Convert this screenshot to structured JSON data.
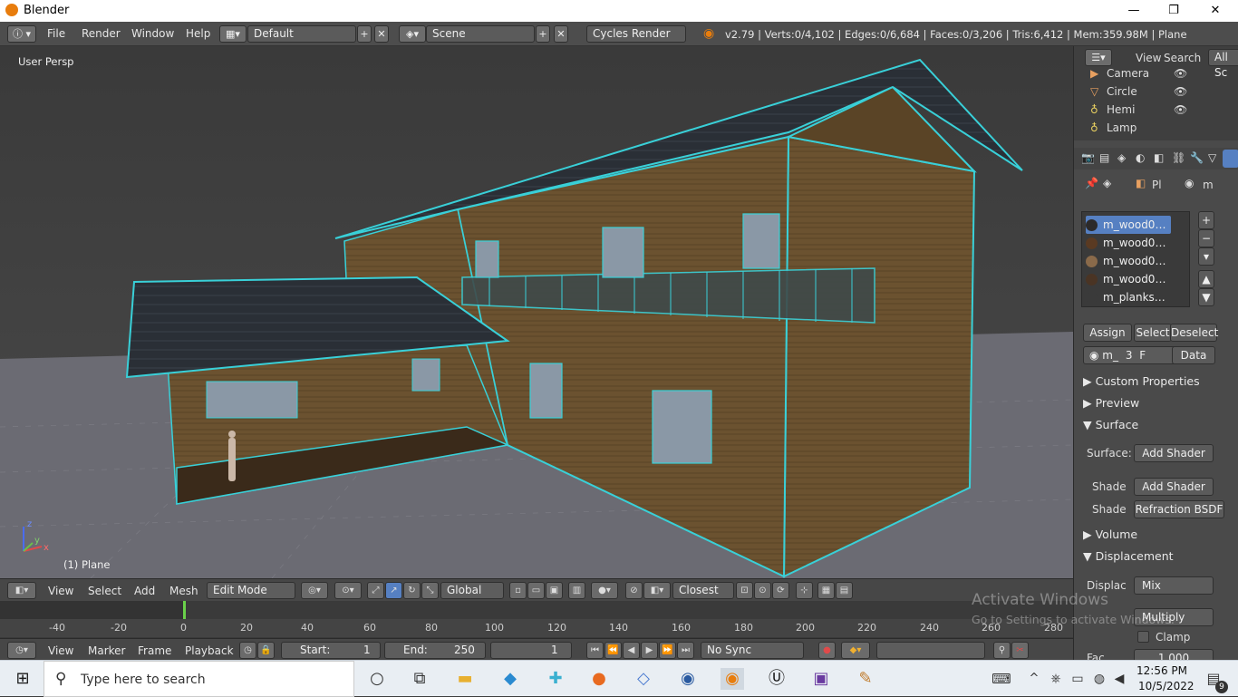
{
  "window": {
    "title": "Blender",
    "minimize": "—",
    "restore": "❐",
    "close": "✕"
  },
  "menubar": {
    "items": [
      "File",
      "Render",
      "Window",
      "Help"
    ],
    "layout": "Default",
    "scene": "Scene",
    "engine": "Cycles Render",
    "stats": "v2.79 | Verts:0/4,102 | Edges:0/6,684 | Faces:0/3,206 | Tris:6,412 | Mem:359.98M | Plane"
  },
  "viewport": {
    "view_label": "User Persp",
    "object_label": "(1) Plane",
    "axis_x": "x",
    "axis_y": "y",
    "axis_z": "z"
  },
  "viewport_header": {
    "menus": [
      "View",
      "Select",
      "Add",
      "Mesh"
    ],
    "mode": "Edit Mode",
    "orientation": "Global",
    "snap": "Closest"
  },
  "timeline": {
    "ticks": [
      "-40",
      "-20",
      "0",
      "20",
      "40",
      "60",
      "80",
      "100",
      "120",
      "140",
      "160",
      "180",
      "200",
      "220",
      "240",
      "260",
      "280"
    ],
    "menus": [
      "View",
      "Marker",
      "Frame",
      "Playback"
    ],
    "start_label": "Start:",
    "start_value": "1",
    "end_label": "End:",
    "end_value": "250",
    "current": "1",
    "sync": "No Sync"
  },
  "outliner": {
    "header": {
      "view": "View",
      "search": "Search",
      "filter": "All Sc"
    },
    "items": [
      "Camera",
      "Circle",
      "Hemi",
      "Lamp"
    ]
  },
  "properties": {
    "breadcrumb": [
      "Pl",
      "m"
    ],
    "materials": [
      {
        "name": "m_wood0…",
        "color": "#2c2a2a",
        "selected": true
      },
      {
        "name": "m_wood0…",
        "color": "#5a3a22"
      },
      {
        "name": "m_wood0…",
        "color": "#8a6a4a"
      },
      {
        "name": "m_wood0…",
        "color": "#4a3424"
      },
      {
        "name": "m_planks…",
        "color": "#3a3a3a"
      }
    ],
    "buttons": {
      "assign": "Assign",
      "select": "Select",
      "deselect": "Deselect"
    },
    "datablock": {
      "name": "m_",
      "users": "3",
      "fake": "F",
      "link": "Data"
    },
    "panels": {
      "custom": "Custom Properties",
      "preview": "Preview",
      "surface": "Surface",
      "volume": "Volume",
      "displacement": "Displacement"
    },
    "surface": {
      "surface_label": "Surface:",
      "surface_value": "Add Shader",
      "shade1_label": "Shade",
      "shade1_value": "Add Shader",
      "shade2_label": "Shade",
      "shade2_value": "Refraction BSDF"
    },
    "displacement": {
      "label": "Displac",
      "value": "Mix",
      "blend": "Multiply",
      "clamp": "Clamp",
      "fac": "Fac",
      "fac_value": "1.000"
    }
  },
  "watermark": {
    "line1": "Activate Windows",
    "line2": "Go to Settings to activate Windows."
  },
  "taskbar": {
    "search_placeholder": "Type here to search",
    "time": "12:56 PM",
    "date": "10/5/2022",
    "notifications": "9"
  },
  "colors": {
    "wire": "#39d0d8",
    "floor": "#6b6b73",
    "sky": "#3d3d3d",
    "wood": "#6b5230",
    "roof": "#2a2f36"
  }
}
